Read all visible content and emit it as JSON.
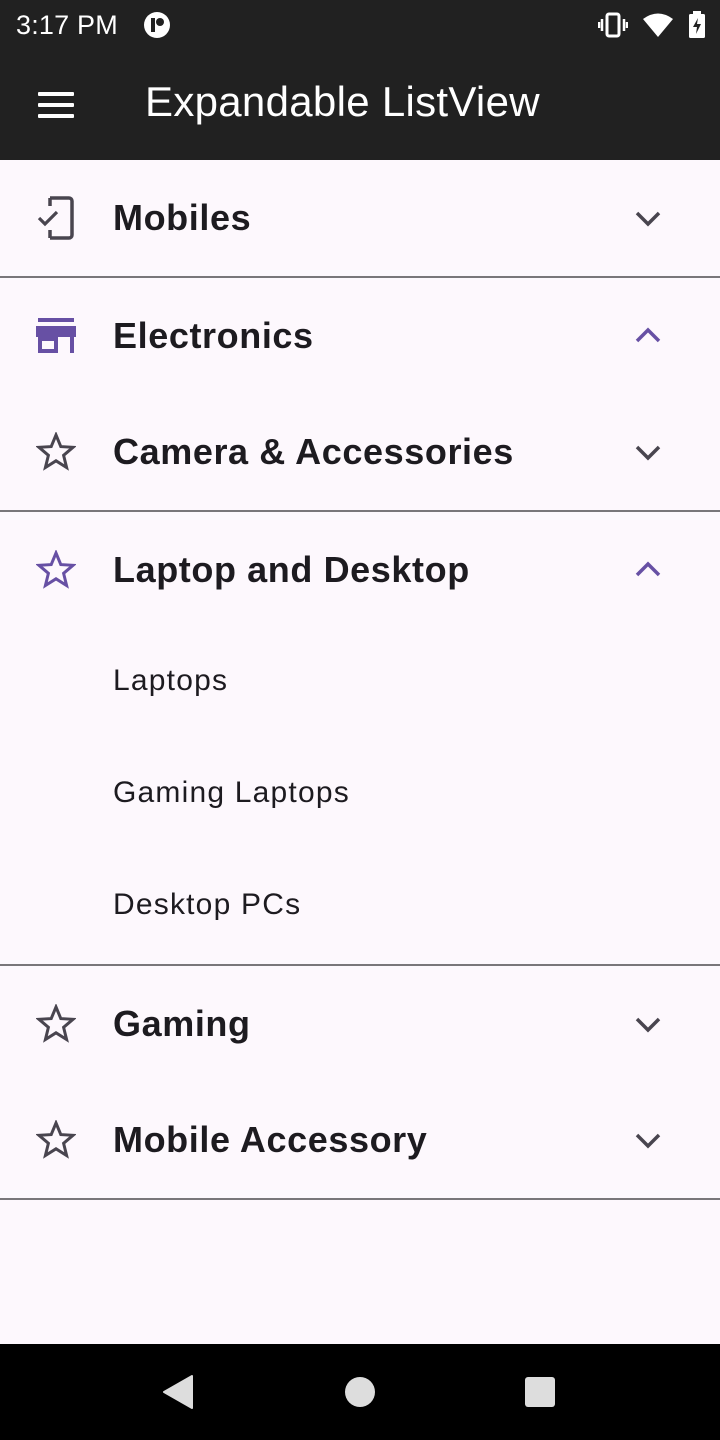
{
  "status_bar": {
    "time": "3:17 PM",
    "icons": [
      "app-notification-icon",
      "vibrate-icon",
      "wifi-icon",
      "battery-charging-icon"
    ]
  },
  "app_bar": {
    "title": "Expandable ListView",
    "menu_icon": "hamburger-menu-icon"
  },
  "colors": {
    "bar_bg": "#212121",
    "surface": "#fdf8fd",
    "accent": "#6750a4",
    "text": "#1d1b20",
    "icon_gray": "#49454f",
    "divider": "#79767a",
    "nav_bg": "#000000"
  },
  "groups": [
    {
      "label": "Mobiles",
      "icon": "phone-check-icon",
      "expanded": false
    },
    {
      "label": "Electronics",
      "icon": "store-icon",
      "expanded": true
    },
    {
      "label": "Camera & Accessories",
      "icon": "star-outline-icon",
      "expanded": false
    },
    {
      "label": "Laptop and Desktop",
      "icon": "star-outline-icon",
      "expanded": true,
      "children": [
        "Laptops",
        "Gaming Laptops",
        "Desktop PCs"
      ]
    },
    {
      "label": "Gaming",
      "icon": "star-outline-icon",
      "expanded": false
    },
    {
      "label": "Mobile Accessory",
      "icon": "star-outline-icon",
      "expanded": false
    }
  ],
  "nav_bar": {
    "buttons": [
      "back-icon",
      "home-icon",
      "recents-icon"
    ]
  }
}
